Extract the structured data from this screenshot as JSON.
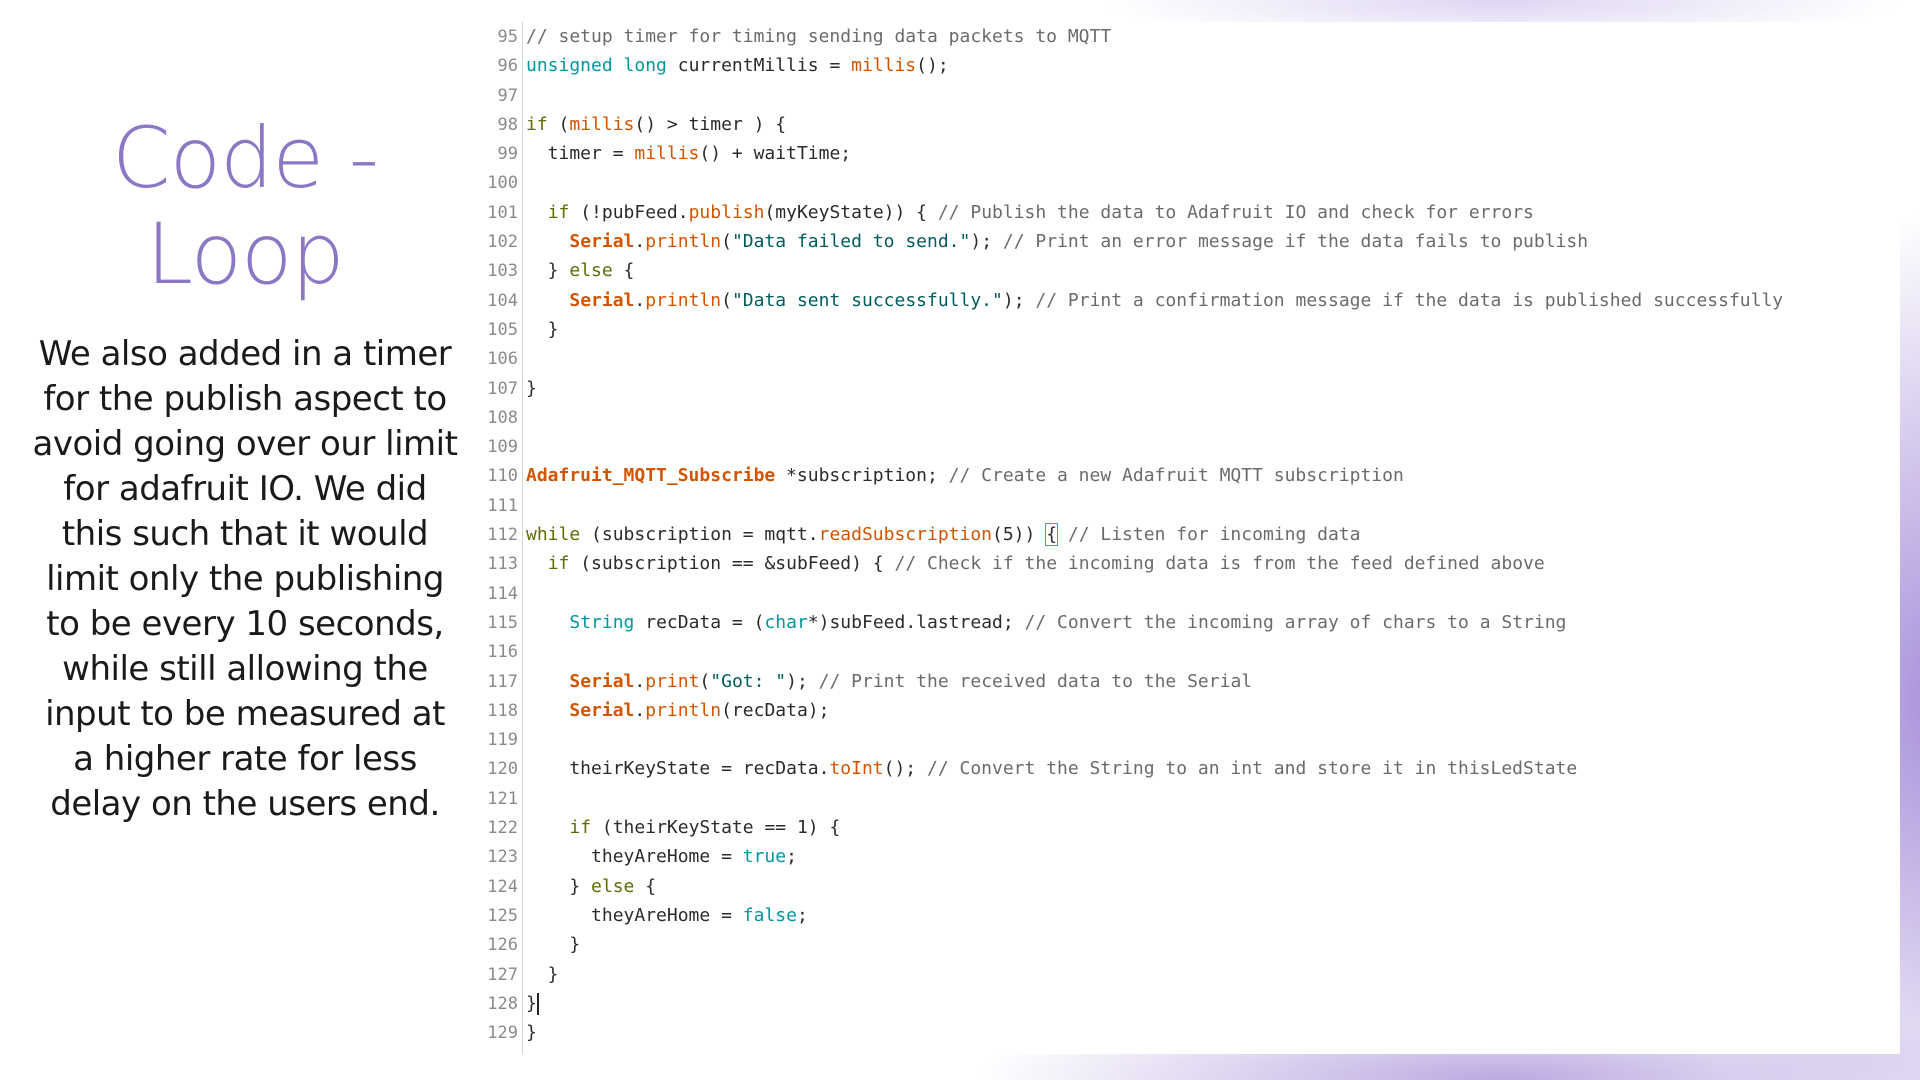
{
  "slide": {
    "title_line1": "Code -",
    "title_line2": "Loop",
    "body": "We also added in a timer for the publish aspect to avoid going over our limit for adafruit IO. We did this such that it would limit only the publishing to be every 10 seconds, while still allowing the input to be measured at a higher rate for less delay on the users end."
  },
  "code": {
    "lines": [
      {
        "n": "95",
        "tokens": [
          [
            "",
            "// setup timer for timing sending data packets to MQTT",
            "c"
          ]
        ]
      },
      {
        "n": "96",
        "tokens": [
          [
            "",
            "unsigned long",
            "t"
          ],
          [
            "",
            " currentMillis = ",
            ""
          ],
          [
            "",
            "millis",
            "f"
          ],
          [
            "",
            "();",
            ""
          ]
        ]
      },
      {
        "n": "97",
        "tokens": []
      },
      {
        "n": "98",
        "tokens": [
          [
            "",
            "if",
            "k"
          ],
          [
            "",
            " (",
            ""
          ],
          [
            "",
            "millis",
            "f"
          ],
          [
            "",
            "() > timer ) {",
            ""
          ]
        ]
      },
      {
        "n": "99",
        "tokens": [
          [
            "",
            "  timer = ",
            ""
          ],
          [
            "",
            "millis",
            "f"
          ],
          [
            "",
            "() + waitTime;",
            ""
          ]
        ]
      },
      {
        "n": "100",
        "tokens": []
      },
      {
        "n": "101",
        "tokens": [
          [
            "",
            "  ",
            ""
          ],
          [
            "",
            "if",
            "k"
          ],
          [
            "",
            " (!pubFeed.",
            ""
          ],
          [
            "",
            "publish",
            "f"
          ],
          [
            "",
            "(myKeyState)) { ",
            ""
          ],
          [
            "",
            "// Publish the data to Adafruit IO and check for errors",
            "c"
          ]
        ]
      },
      {
        "n": "102",
        "tokens": [
          [
            "",
            "    ",
            ""
          ],
          [
            "",
            "Serial",
            "fb"
          ],
          [
            "",
            ".",
            ""
          ],
          [
            "",
            "println",
            "f"
          ],
          [
            "",
            "(",
            ""
          ],
          [
            "",
            "\"Data failed to send.\"",
            "s"
          ],
          [
            "",
            "); ",
            ""
          ],
          [
            "",
            "// Print an error message if the data fails to publish",
            "c"
          ]
        ]
      },
      {
        "n": "103",
        "tokens": [
          [
            "",
            "  } ",
            ""
          ],
          [
            "",
            "else",
            "k"
          ],
          [
            "",
            " {",
            ""
          ]
        ]
      },
      {
        "n": "104",
        "tokens": [
          [
            "",
            "    ",
            ""
          ],
          [
            "",
            "Serial",
            "fb"
          ],
          [
            "",
            ".",
            ""
          ],
          [
            "",
            "println",
            "f"
          ],
          [
            "",
            "(",
            ""
          ],
          [
            "",
            "\"Data sent successfully.\"",
            "s"
          ],
          [
            "",
            "); ",
            ""
          ],
          [
            "",
            "// Print a confirmation message if the data is published successfully",
            "c"
          ]
        ]
      },
      {
        "n": "105",
        "tokens": [
          [
            "",
            "  }",
            ""
          ]
        ]
      },
      {
        "n": "106",
        "tokens": []
      },
      {
        "n": "107",
        "tokens": [
          [
            "",
            "}",
            ""
          ]
        ]
      },
      {
        "n": "108",
        "tokens": []
      },
      {
        "n": "109",
        "tokens": []
      },
      {
        "n": "110",
        "tokens": [
          [
            "",
            "Adafruit_MQTT_Subscribe",
            "fb"
          ],
          [
            "",
            " *subscription; ",
            ""
          ],
          [
            "",
            "// Create a new Adafruit MQTT subscription",
            "c"
          ]
        ]
      },
      {
        "n": "111",
        "tokens": []
      },
      {
        "n": "112",
        "tokens": [
          [
            "",
            "while",
            "k"
          ],
          [
            "",
            " (subscription = mqtt.",
            ""
          ],
          [
            "",
            "readSubscription",
            "f"
          ],
          [
            "",
            "(5)) ",
            ""
          ],
          [
            "",
            "{",
            "hl"
          ],
          [
            "",
            " ",
            ""
          ],
          [
            "",
            "// Listen for incoming data",
            "c"
          ]
        ]
      },
      {
        "n": "113",
        "tokens": [
          [
            "",
            "  ",
            ""
          ],
          [
            "",
            "if",
            "k"
          ],
          [
            "",
            " (subscription == &subFeed) { ",
            ""
          ],
          [
            "",
            "// Check if the incoming data is from the feed defined above",
            "c"
          ]
        ]
      },
      {
        "n": "114",
        "tokens": []
      },
      {
        "n": "115",
        "tokens": [
          [
            "",
            "    ",
            ""
          ],
          [
            "",
            "String",
            "t"
          ],
          [
            "",
            " recData = (",
            ""
          ],
          [
            "",
            "char",
            "t"
          ],
          [
            "",
            "*)subFeed.lastread; ",
            ""
          ],
          [
            "",
            "// Convert the incoming array of chars to a String",
            "c"
          ]
        ]
      },
      {
        "n": "116",
        "tokens": []
      },
      {
        "n": "117",
        "tokens": [
          [
            "",
            "    ",
            ""
          ],
          [
            "",
            "Serial",
            "fb"
          ],
          [
            "",
            ".",
            ""
          ],
          [
            "",
            "print",
            "f"
          ],
          [
            "",
            "(",
            ""
          ],
          [
            "",
            "\"Got: \"",
            "s"
          ],
          [
            "",
            "); ",
            ""
          ],
          [
            "",
            "// Print the received data to the Serial",
            "c"
          ]
        ]
      },
      {
        "n": "118",
        "tokens": [
          [
            "",
            "    ",
            ""
          ],
          [
            "",
            "Serial",
            "fb"
          ],
          [
            "",
            ".",
            ""
          ],
          [
            "",
            "println",
            "f"
          ],
          [
            "",
            "(recData);",
            ""
          ]
        ]
      },
      {
        "n": "119",
        "tokens": []
      },
      {
        "n": "120",
        "tokens": [
          [
            "",
            "    theirKeyState = recData.",
            ""
          ],
          [
            "",
            "toInt",
            "f"
          ],
          [
            "",
            "(); ",
            ""
          ],
          [
            "",
            "// Convert the String to an int and store it in thisLedState",
            "c"
          ]
        ]
      },
      {
        "n": "121",
        "tokens": []
      },
      {
        "n": "122",
        "tokens": [
          [
            "",
            "    ",
            ""
          ],
          [
            "",
            "if",
            "k"
          ],
          [
            "",
            " (theirKeyState == 1) {",
            ""
          ]
        ]
      },
      {
        "n": "123",
        "tokens": [
          [
            "",
            "      theyAreHome = ",
            ""
          ],
          [
            "",
            "true",
            "t"
          ],
          [
            "",
            ";",
            ""
          ]
        ]
      },
      {
        "n": "124",
        "tokens": [
          [
            "",
            "    } ",
            ""
          ],
          [
            "",
            "else",
            "k"
          ],
          [
            "",
            " {",
            ""
          ]
        ]
      },
      {
        "n": "125",
        "tokens": [
          [
            "",
            "      theyAreHome = ",
            ""
          ],
          [
            "",
            "false",
            "t"
          ],
          [
            "",
            ";",
            ""
          ]
        ]
      },
      {
        "n": "126",
        "tokens": [
          [
            "",
            "    }",
            ""
          ]
        ]
      },
      {
        "n": "127",
        "tokens": [
          [
            "",
            "  }",
            ""
          ]
        ]
      },
      {
        "n": "128",
        "tokens": [
          [
            "",
            "}",
            ""
          ],
          [
            "",
            "",
            "caret"
          ]
        ]
      },
      {
        "n": "129",
        "tokens": [
          [
            "",
            "}",
            ""
          ]
        ]
      }
    ]
  }
}
